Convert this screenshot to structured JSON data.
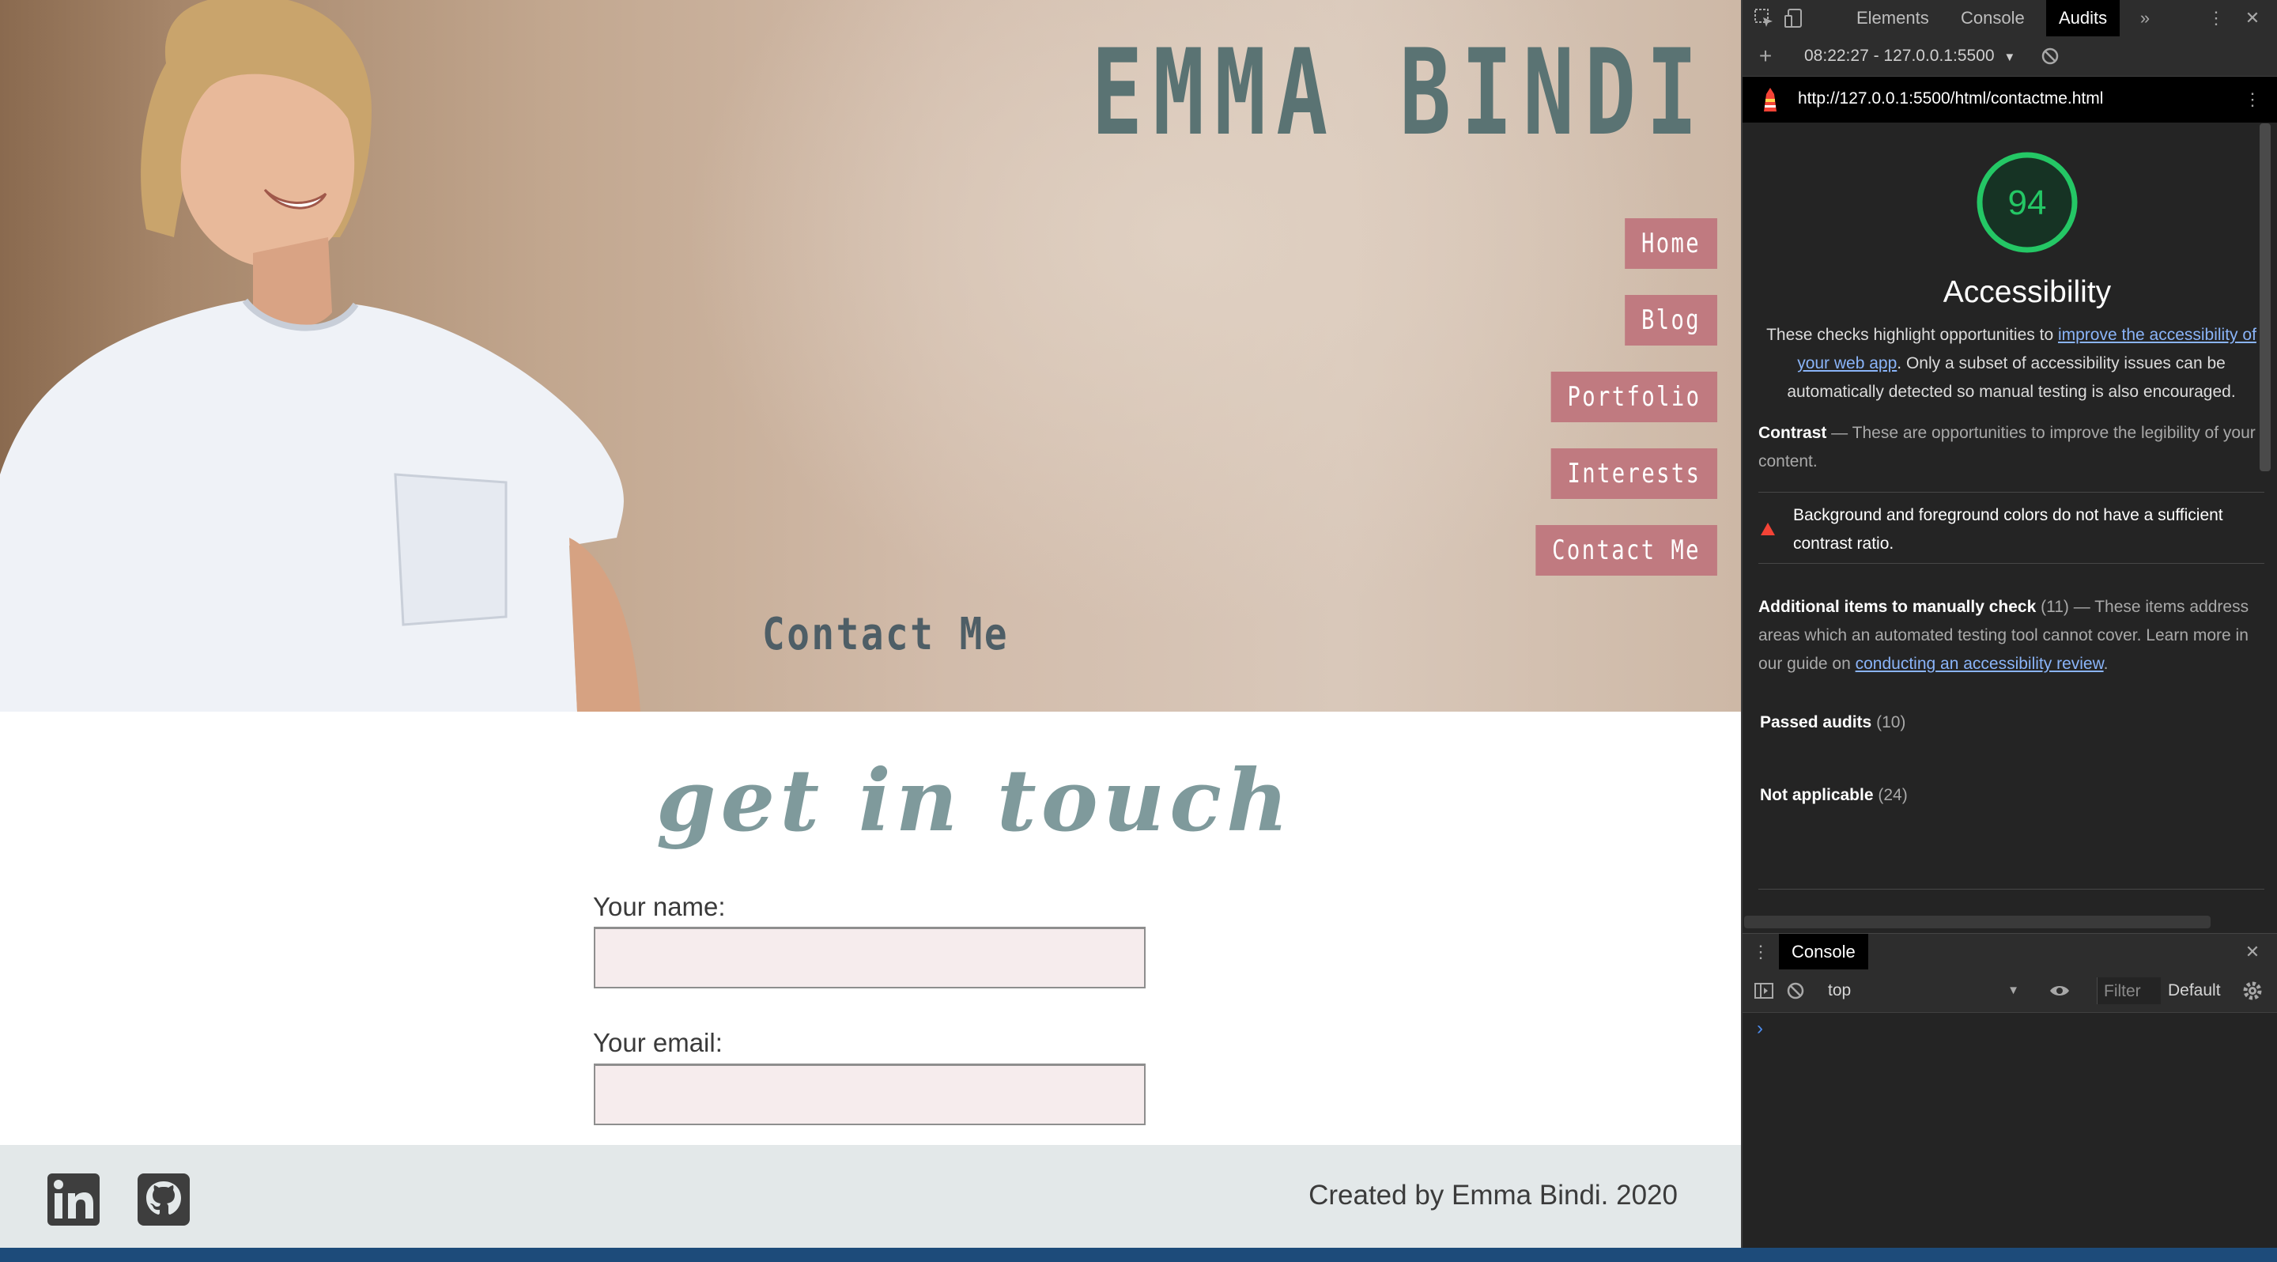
{
  "site": {
    "title": "EMMA BINDI",
    "nav": [
      "Home",
      "Blog",
      "Portfolio",
      "Interests",
      "Contact Me"
    ],
    "hero_caption": "Contact Me",
    "heading": "get in touch",
    "form": {
      "name_label": "Your name:",
      "email_label": "Your email:"
    },
    "footer": {
      "credit": "Created by Emma Bindi. 2020",
      "icons": [
        "linkedin-icon",
        "github-icon"
      ]
    },
    "colors": {
      "nav_bg": "#c07a80",
      "title": "#5a7373",
      "heading": "#7f9a9c",
      "field_bg": "#f6eced",
      "footer_bg": "#e3e8e9"
    }
  },
  "devtools": {
    "tabs": [
      "Elements",
      "Console",
      "Audits"
    ],
    "active_tab": "Audits",
    "report_label": "08:22:27 - 127.0.0.1:5500",
    "url": "http://127.0.0.1:5500/html/contactme.html",
    "score": "94",
    "category": "Accessibility",
    "intro": {
      "before": "These checks highlight opportunities to ",
      "link": "improve the accessibility of your web app",
      "after": ". Only a subset of accessibility issues can be automatically detected so manual testing is also encouraged."
    },
    "contrast": {
      "title": "Contrast",
      "text": "These are opportunities to improve the legibility of your content.",
      "audit": "Background and foreground colors do not have a sufficient contrast ratio."
    },
    "manual": {
      "title": "Additional items to manually check",
      "count": "(11)",
      "text": "These items address areas which an automated testing tool cannot cover. Learn more in our guide on ",
      "link": "conducting an accessibility review",
      "end": "."
    },
    "passed": {
      "title": "Passed audits",
      "count": "(10)"
    },
    "not_applicable": {
      "title": "Not applicable",
      "count": "(24)"
    },
    "console": {
      "tab": "Console",
      "context": "top",
      "filter_placeholder": "Filter",
      "levels": "Default",
      "prompt": "›"
    },
    "colors": {
      "score": "#24c765",
      "link": "#8ab4f8",
      "fail": "#f44336"
    }
  }
}
